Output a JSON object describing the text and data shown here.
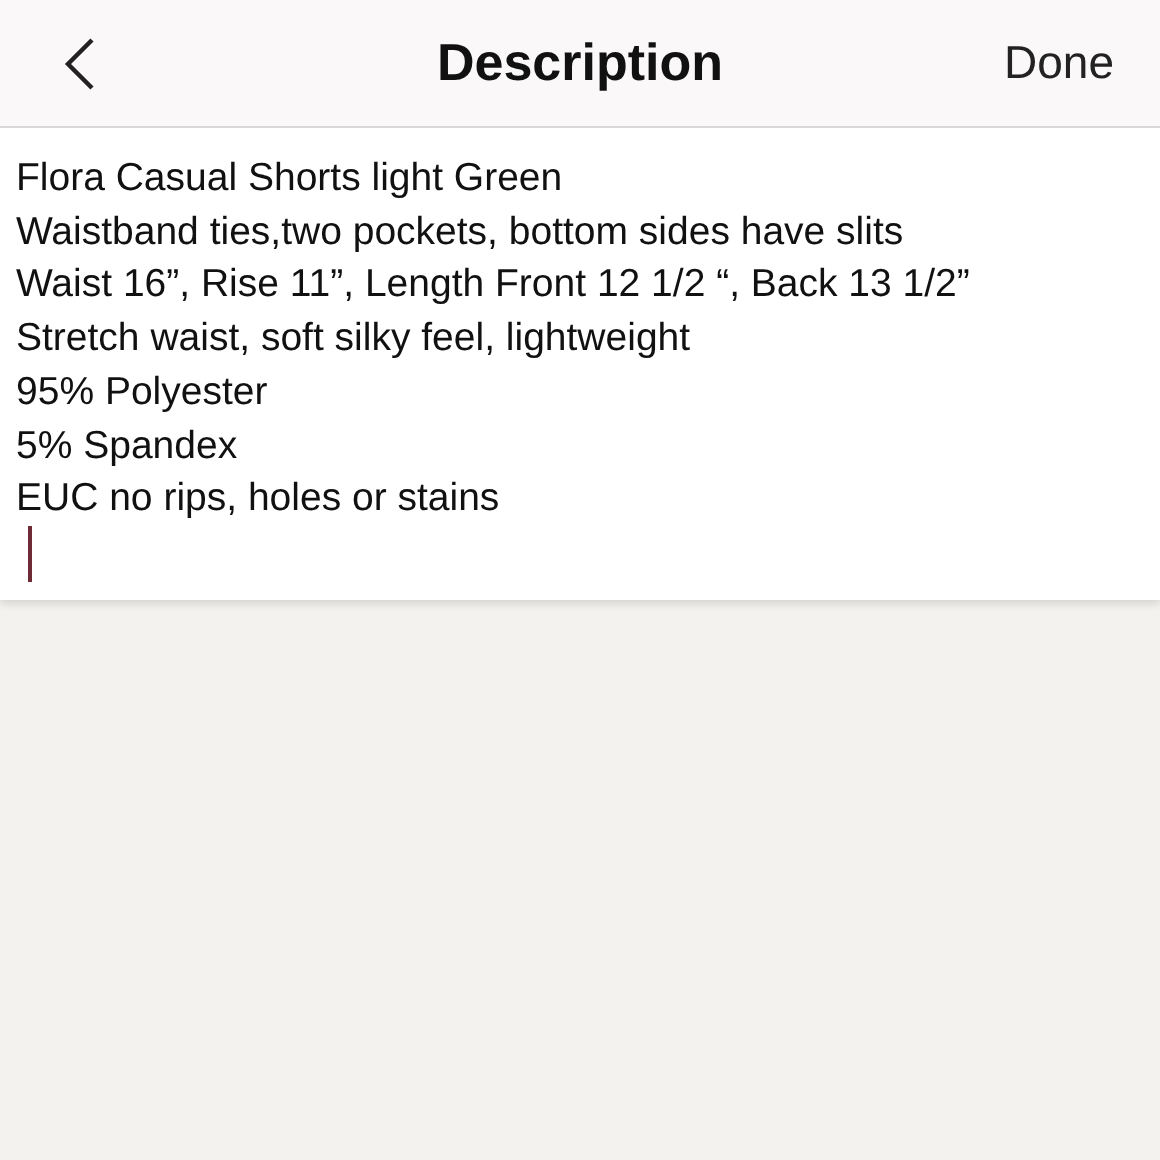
{
  "header": {
    "title": "Description",
    "done_label": "Done"
  },
  "description_lines": [
    "Flora Casual Shorts light Green",
    "Waistband ties,two pockets, bottom sides have slits",
    "Waist 16”, Rise 11”, Length Front 12 1/2 “, Back 13 1/2”",
    "Stretch waist, soft silky feel, lightweight",
    "95% Polyester",
    "5% Spandex",
    "EUC no rips, holes or stains"
  ]
}
